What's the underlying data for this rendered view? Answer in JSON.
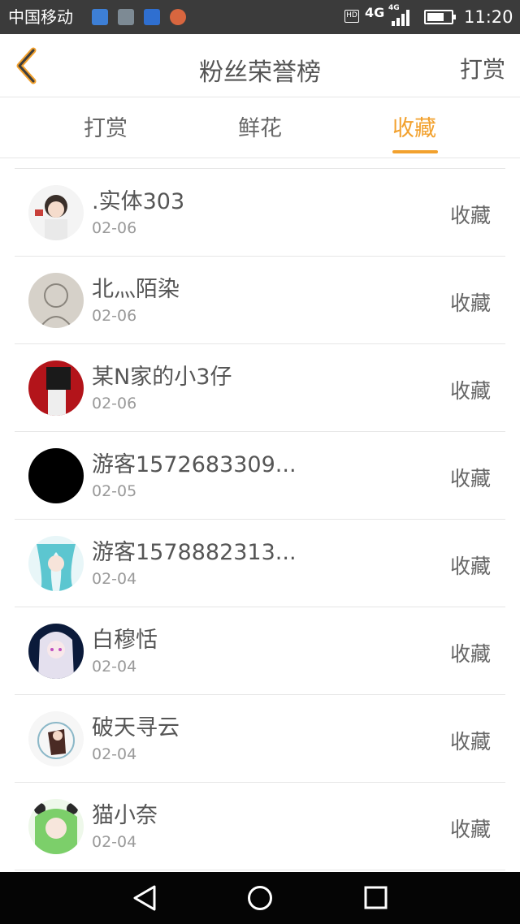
{
  "status_bar": {
    "carrier": "中国移动",
    "hd": "HD",
    "network": "4G",
    "network_small": "4G",
    "time": "11:20",
    "battery_level": 0.72
  },
  "header": {
    "title": "粉丝荣誉榜",
    "right_action": "打赏"
  },
  "tabs": [
    {
      "label": "打赏"
    },
    {
      "label": "鲜花"
    },
    {
      "label": "收藏"
    }
  ],
  "active_tab": "收藏",
  "list": [
    {
      "name": ".实体303",
      "date": "02-06",
      "action": "收藏"
    },
    {
      "name": "北灬陌染",
      "date": "02-06",
      "action": "收藏"
    },
    {
      "name": "某N家的小3仔",
      "date": "02-06",
      "action": "收藏"
    },
    {
      "name": "游客1572683309...",
      "date": "02-05",
      "action": "收藏"
    },
    {
      "name": "游客1578882313...",
      "date": "02-04",
      "action": "收藏"
    },
    {
      "name": "白穆恬",
      "date": "02-04",
      "action": "收藏"
    },
    {
      "name": "破天寻云",
      "date": "02-04",
      "action": "收藏"
    },
    {
      "name": "猫小奈",
      "date": "02-04",
      "action": "收藏"
    }
  ],
  "colors": {
    "accent": "#f2a12e",
    "text": "#555555",
    "subtext": "#9a9a9a",
    "divider": "#e6e6e6",
    "status_bar": "#3b3b3b",
    "nav_bar": "#050505"
  },
  "icons": {
    "back": "chevron-left-icon",
    "nav_back": "triangle-back-icon",
    "nav_home": "circle-home-icon",
    "nav_recent": "square-recent-icon"
  }
}
